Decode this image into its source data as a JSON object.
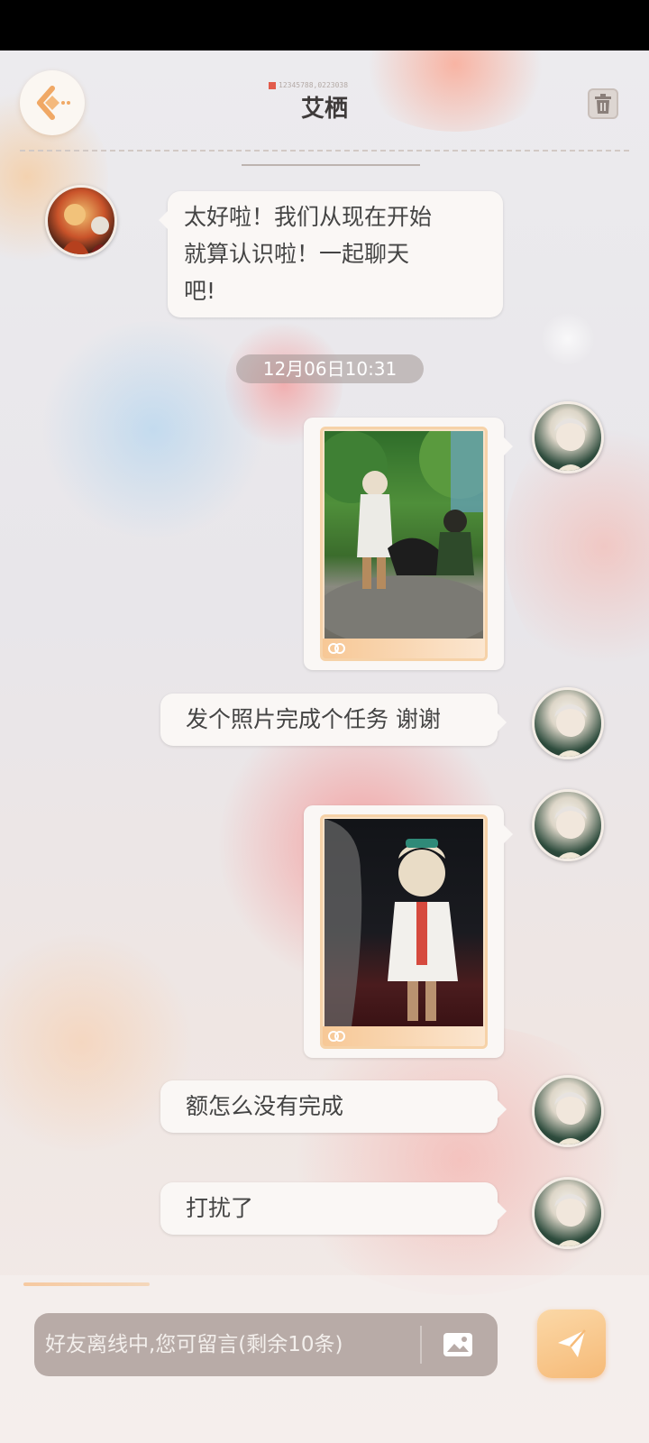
{
  "header": {
    "title": "艾栖",
    "uid": "12345788,0223038",
    "back_icon": "chevron-left-icon",
    "delete_icon": "trash-icon"
  },
  "messages": [
    {
      "sender": "friend",
      "type": "text",
      "text_lines": [
        "太好啦！我们从现在开始",
        "就算认识啦！一起聊天",
        "吧!"
      ]
    },
    {
      "type": "timestamp",
      "text": "12月06日10:31"
    },
    {
      "sender": "me",
      "type": "photo",
      "scene": "forest"
    },
    {
      "sender": "me",
      "type": "text",
      "text": "发个照片完成个任务 谢谢"
    },
    {
      "sender": "me",
      "type": "photo",
      "scene": "dark-room"
    },
    {
      "sender": "me",
      "type": "text",
      "text": "额怎么没有完成"
    },
    {
      "sender": "me",
      "type": "text",
      "text": "打扰了"
    }
  ],
  "input": {
    "placeholder": "好友离线中,您可留言(剩余10条)",
    "photo_icon": "image-icon",
    "send_icon": "send-icon"
  },
  "colors": {
    "bubble": "#faf7f5",
    "accent": "#f6ba77",
    "input_bg": "#b8aba7",
    "timestamp_bg": "#a0969488"
  }
}
